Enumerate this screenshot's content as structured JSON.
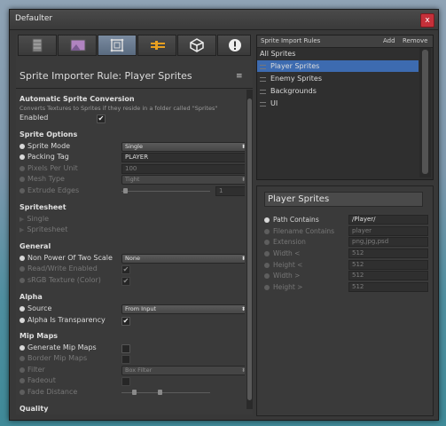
{
  "window": {
    "title": "Defaulter",
    "close_label": "x"
  },
  "toolbar": {
    "buttons": [
      {
        "icon": "texture-icon"
      },
      {
        "icon": "image-icon"
      },
      {
        "icon": "sprite-icon"
      },
      {
        "icon": "audio-icon"
      },
      {
        "icon": "unity-icon"
      },
      {
        "icon": "alert-icon"
      }
    ]
  },
  "rule": {
    "title": "Sprite Importer Rule: Player Sprites",
    "menu_icon": "≡"
  },
  "sections": {
    "auto": {
      "title": "Automatic Sprite Conversion",
      "note": "Converts Textures to Sprites if they reside in a folder called \"Sprites\"",
      "enabled_label": "Enabled",
      "enabled": "✔"
    },
    "options": {
      "title": "Sprite Options",
      "sprite_mode_label": "Sprite Mode",
      "sprite_mode_value": "Single",
      "packing_tag_label": "Packing Tag",
      "packing_tag_value": "PLAYER",
      "ppu_label": "Pixels Per Unit",
      "ppu_value": "100",
      "mesh_label": "Mesh Type",
      "mesh_value": "Tight",
      "extrude_label": "Extrude Edges",
      "extrude_value": "1"
    },
    "spritesheet": {
      "title": "Spritesheet",
      "single": "Single",
      "sheet": "Spritesheet"
    },
    "general": {
      "title": "General",
      "npot_label": "Non Power Of Two Scale",
      "npot_value": "None",
      "rw_label": "Read/Write Enabled",
      "rw": "✔",
      "srgb_label": "sRGB Texture (Color)",
      "srgb": "✔"
    },
    "alpha": {
      "title": "Alpha",
      "source_label": "Source",
      "source_value": "From Input",
      "transp_label": "Alpha Is Transparency",
      "transp": "✔"
    },
    "mip": {
      "title": "Mip Maps",
      "gen_label": "Generate Mip Maps",
      "border_label": "Border Mip Maps",
      "filter_label": "Filter",
      "filter_value": "Box Filter",
      "fadeout_label": "Fadeout",
      "fade_label": "Fade Distance"
    },
    "quality": {
      "title": "Quality"
    }
  },
  "rules_list": {
    "header": "Sprite Import Rules",
    "add": "Add",
    "remove": "Remove",
    "items": [
      "All Sprites",
      "Player Sprites",
      "Enemy Sprites",
      "Backgrounds",
      "UI"
    ]
  },
  "detail": {
    "title": "Player Sprites",
    "rows": [
      {
        "label": "Path Contains",
        "value": "/Player/"
      },
      {
        "label": "Filename Contains",
        "value": "player"
      },
      {
        "label": "Extension",
        "value": "png,jpg,psd"
      },
      {
        "label": "Width  <",
        "value": "512"
      },
      {
        "label": "Height <",
        "value": "512"
      },
      {
        "label": "Width  >",
        "value": "512"
      },
      {
        "label": "Height >",
        "value": "512"
      }
    ]
  }
}
